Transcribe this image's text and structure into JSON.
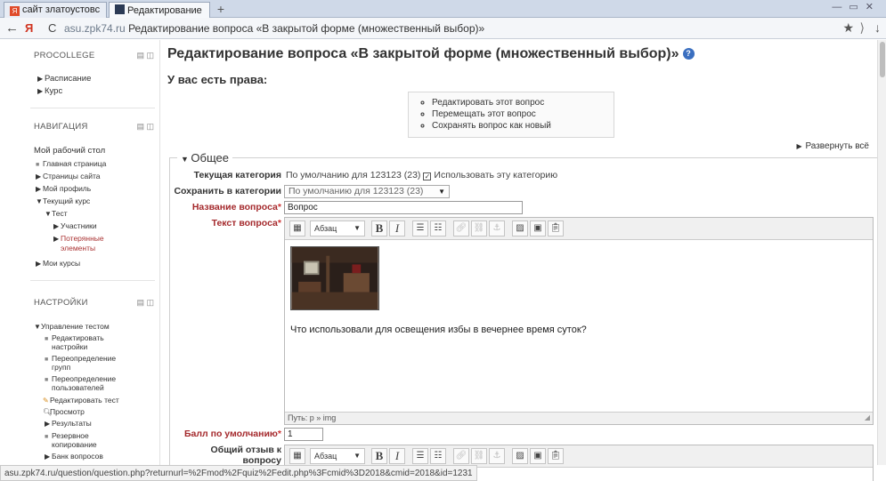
{
  "browser": {
    "tabs": [
      {
        "label": "сайт златоустовс",
        "active": false
      },
      {
        "label": "Редактирование",
        "active": true
      }
    ],
    "tab_close": "×",
    "new_tab": "+",
    "back": "←",
    "yandex": "Я",
    "reload": "C",
    "url_host": "asu.zpk74.ru",
    "url_title": "Редактирование вопроса «В закрытой форме (множественный выбор)»",
    "status_url": "asu.zpk74.ru/question/question.php?returnurl=%2Fmod%2Fquiz%2Fedit.php%3Fcmid%3D2018&cmid=2018&id=1231"
  },
  "sidebar": {
    "procollege": {
      "title": "PROCOLLEGE",
      "items": [
        "Расписание",
        "Курс"
      ]
    },
    "navigation": {
      "title": "НАВИГАЦИЯ",
      "items": [
        "Мой рабочий стол",
        "Главная страница",
        "Страницы сайта",
        "Мой профиль",
        "Текущий курс",
        "Тест",
        "Участники",
        "Потерянные",
        "элементы",
        "Мои курсы"
      ]
    },
    "settings": {
      "title": "НАСТРОЙКИ",
      "items": [
        "Управление тестом",
        "Редактировать",
        "настройки",
        "Переопределение",
        "групп",
        "Переопределение",
        "пользователей",
        "Редактировать тест",
        "Просмотр",
        "Результаты",
        "Резервное",
        "копирование",
        "Банк вопросов"
      ]
    }
  },
  "main": {
    "title": "Редактирование вопроса «В закрытой форме (множественный выбор)»",
    "rights_heading": "У вас есть права:",
    "rights": [
      "Редактировать этот вопрос",
      "Перемещать этот вопрос",
      "Сохранять вопрос как новый"
    ],
    "expand_all": "Развернуть всё",
    "section_general": "Общее",
    "fields": {
      "current_category_label": "Текущая категория",
      "current_category_value": "По умолчанию для 123123 (23)",
      "use_category": "Использовать эту категорию",
      "save_in_category_label": "Сохранить в категории",
      "save_in_category_value": "По умолчанию для 123123 (23)",
      "name_label": "Название вопроса",
      "name_value": "Вопрос",
      "text_label": "Текст вопроса",
      "question_text": "Что использовали для освещения избы в вечернее время суток?",
      "editor_path": "Путь: p » img",
      "format": "Абзац",
      "default_mark_label": "Балл по умолчанию",
      "default_mark_value": "1",
      "feedback_label_1": "Общий отзыв к",
      "feedback_label_2": "вопросу",
      "format2": "Абзац"
    }
  },
  "colors": {
    "required": "#a4292c",
    "link_red": "#a33",
    "help_blue": "#3a6fc0"
  }
}
